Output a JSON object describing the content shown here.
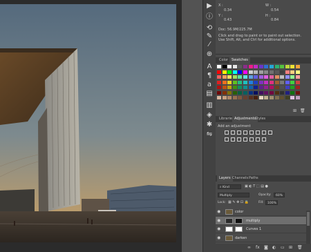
{
  "info": {
    "x_label": "X :",
    "y_label": "Y :",
    "x_value": "0.34",
    "y_value": "0.43",
    "w_label": "W :",
    "h_label": "H :",
    "w_value": "0.54",
    "h_value": "0.84",
    "doc_size": "Doc: 56.9M/225.7M",
    "hint_text": "Click and drag to paint or to paint out selection. Use Shift, Alt, and Ctrl for additional options."
  },
  "swatches_tabs": [
    "Color",
    "Swatches"
  ],
  "adjust_tabs": [
    "Libraries",
    "Adjustments",
    "Styles"
  ],
  "adjust_title": "Add an adjustment",
  "layers_tabs": [
    "Layers",
    "Channels",
    "Paths"
  ],
  "layers_controls": {
    "kind": "Kind",
    "blend_mode": "Multiply",
    "opacity_label": "Opacity:",
    "opacity_value": "60%",
    "lock_label": "Lock:",
    "fill_label": "Fill:",
    "fill_value": "100%"
  },
  "layers": [
    {
      "name": "color",
      "selected": false
    },
    {
      "name": "multiply",
      "selected": true
    },
    {
      "name": "Curves 1",
      "selected": false
    },
    {
      "name": "darken",
      "selected": false
    },
    {
      "name": "Background",
      "selected": false
    }
  ],
  "tool_icons": [
    "play-icon",
    "info-icon",
    "history-icon",
    "brush-preset-icon",
    "brush-icon",
    "clone-source-icon",
    "character-icon",
    "paragraph-icon",
    "glyphs-icon",
    "notes-icon",
    "properties-icon",
    "3d-icon",
    "settings-icon",
    "timeline-icon"
  ],
  "swatch_colors": [
    [
      "#ffffff",
      "#000000",
      "#ffffff",
      "#e6e6e6",
      "#5a5a5a",
      "#8c2c8c",
      "#ee1c8a",
      "#c42ac4",
      "#6b35c6",
      "#2e6ed4",
      "#27a6d6",
      "#2bb26e",
      "#55c23f",
      "#c1d83b",
      "#efe234",
      "#f4a33a"
    ],
    [
      "#ff0000",
      "#ffff00",
      "#00ff00",
      "#00ffff",
      "#0000ff",
      "#ff00ff",
      "#cfcfcf",
      "#b8b8b8",
      "#a0a0a0",
      "#888",
      "#707070",
      "#585858",
      "#404040",
      "#ff8080",
      "#ffd080",
      "#ffff80"
    ],
    [
      "#f06060",
      "#f4a060",
      "#f8e060",
      "#a0e060",
      "#60e0a0",
      "#60e0e0",
      "#60a0e0",
      "#6060e0",
      "#a060e0",
      "#e060e0",
      "#e060a0",
      "#e09060",
      "#c0c0c0",
      "#9090ff",
      "#90ff90",
      "#ffa0a0"
    ],
    [
      "#e02020",
      "#f07020",
      "#f0d020",
      "#60c020",
      "#20c080",
      "#20c0c0",
      "#2080e0",
      "#2040c0",
      "#8030c0",
      "#c030c0",
      "#e03080",
      "#a06030",
      "#7a7a7a",
      "#6060ff",
      "#40d040",
      "#d04040"
    ],
    [
      "#b01010",
      "#c05010",
      "#c0a010",
      "#409010",
      "#109060",
      "#109090",
      "#1060b0",
      "#102090",
      "#602090",
      "#902090",
      "#b01060",
      "#704020",
      "#505050",
      "#4040c0",
      "#20a020",
      "#a02020"
    ],
    [
      "#700808",
      "#803008",
      "#807008",
      "#286008",
      "#086040",
      "#086060",
      "#083080",
      "#081060",
      "#401060",
      "#601060",
      "#700840",
      "#503010",
      "#303030",
      "#202080",
      "#107010",
      "#701010"
    ],
    [
      "#d8b8a0",
      "#c8a080",
      "#b08868",
      "#987050",
      "#805840",
      "#684030",
      "#583020",
      "#482010",
      "#e8d8c0",
      "#c0b090",
      "#a09070",
      "#807050",
      "#605030",
      "#404020",
      "#e0c0e0",
      "#c0a0c0"
    ]
  ]
}
